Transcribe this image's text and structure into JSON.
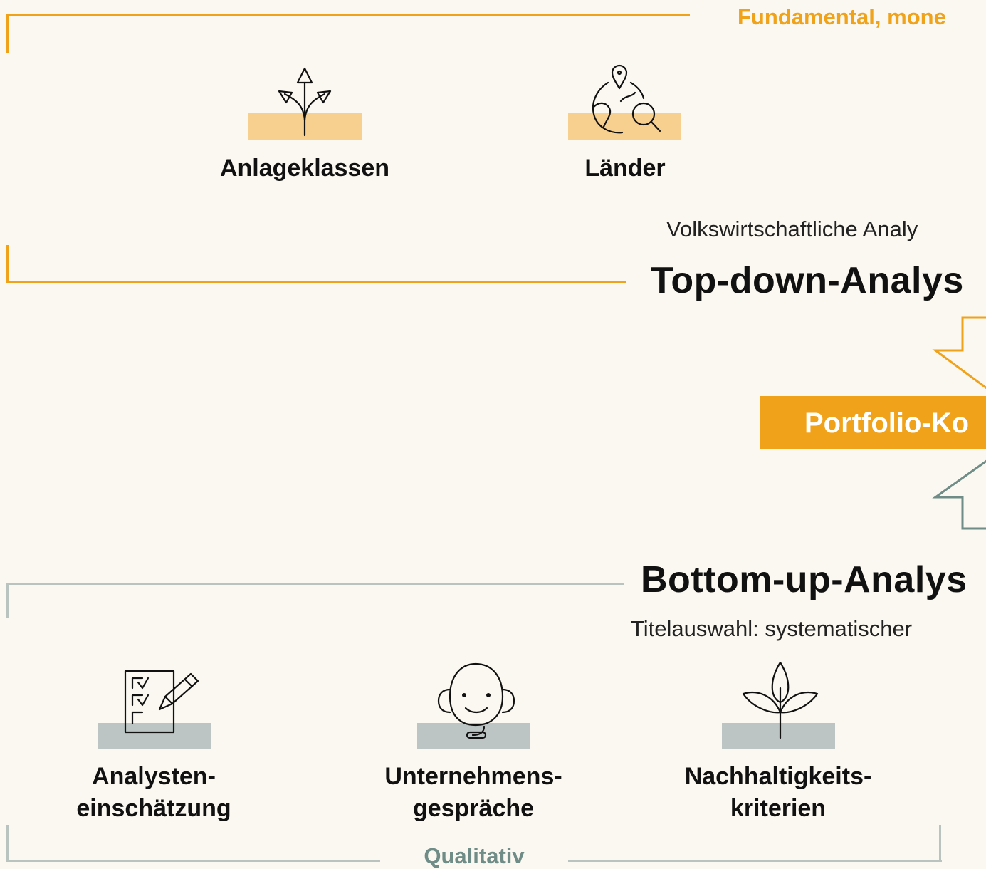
{
  "top_bracket": {
    "caption": "Fundamental, mone",
    "items": [
      {
        "label": "Anlageklassen",
        "icon": "branching-arrows-icon"
      },
      {
        "label": "Länder",
        "icon": "globe-search-icon"
      }
    ],
    "subtitle": "Volkswirtschaftliche Analy",
    "heading": "Top-down-Analys"
  },
  "center": {
    "box_label": "Portfolio-Ko"
  },
  "bottom_bracket": {
    "heading": "Bottom-up-Analys",
    "subtitle": "Titelauswahl: systematischer",
    "items": [
      {
        "line1": "Analysten-",
        "line2": "einschätzung",
        "icon": "checklist-pen-icon"
      },
      {
        "line1": "Unternehmens-",
        "line2": "gespräche",
        "icon": "headset-face-icon"
      },
      {
        "line1": "Nachhaltigkeits-",
        "line2": "kriterien",
        "icon": "sprout-icon"
      }
    ],
    "caption": "Qualitativ"
  },
  "colors": {
    "orange": "#f0a21a",
    "orange_light": "#f7cf8f",
    "grey": "#b9c4c0",
    "grey_dark": "#6f8c86",
    "background": "#faf8f0"
  }
}
